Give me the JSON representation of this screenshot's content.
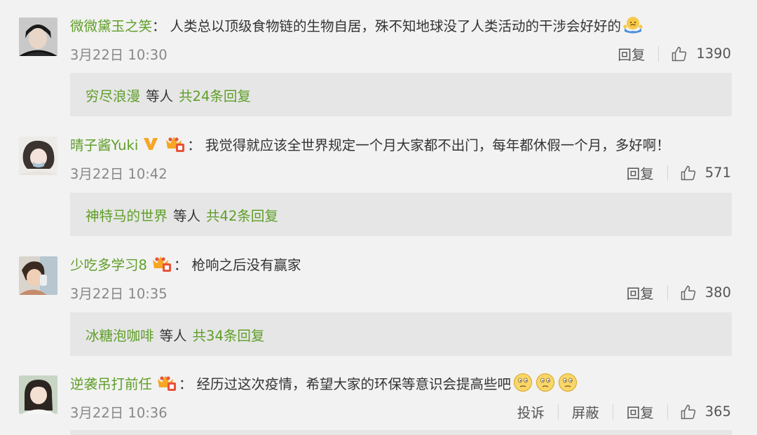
{
  "comments": [
    {
      "username": "微微黛玉之笑",
      "text": "人类总以顶级食物链的生物自居，殊不知地球没了人类活动的干涉会好好的",
      "emoji": [
        "shrug-emoji"
      ],
      "time": "3月22日 10:30",
      "actions": [
        "回复"
      ],
      "likes": "1390",
      "badges": [],
      "reply_summary": {
        "name": "穷尽浪漫",
        "etc": "等人",
        "total": "共24条回复"
      }
    },
    {
      "username": "晴子酱Yuki",
      "text": "我觉得就应该全世界规定一个月大家都不出门，每年都休假一个月，多好啊！",
      "emoji": [],
      "time": "3月22日 10:42",
      "actions": [
        "回复"
      ],
      "likes": "571",
      "badges": [
        "verified-v-icon",
        "vip-crown-icon"
      ],
      "reply_summary": {
        "name": "神特马的世界",
        "etc": "等人",
        "total": "共42条回复"
      }
    },
    {
      "username": "少吃多学习8",
      "text": "枪响之后没有赢家",
      "emoji": [],
      "time": "3月22日 10:35",
      "actions": [
        "回复"
      ],
      "likes": "380",
      "badges": [
        "vip-crown-icon"
      ],
      "reply_summary": {
        "name": "冰糖泡咖啡",
        "etc": "等人",
        "total": "共34条回复"
      }
    },
    {
      "username": "逆袭吊打前任",
      "text": "经历过这次疫情，希望大家的环保等意识会提高些吧",
      "emoji": [
        "thinking-emoji",
        "thinking-emoji",
        "thinking-emoji"
      ],
      "time": "3月22日 10:36",
      "actions": [
        "投诉",
        "屏蔽",
        "回复"
      ],
      "likes": "365",
      "badges": [
        "vip-crown-icon"
      ]
    }
  ],
  "colors": {
    "background": "#f2f2f2",
    "username": "#5f9e28",
    "text": "#333333",
    "meta": "#888888",
    "reply_box": "#e6e6e6",
    "vip_gold": "#f6a623",
    "vip_red": "#e8533b"
  }
}
